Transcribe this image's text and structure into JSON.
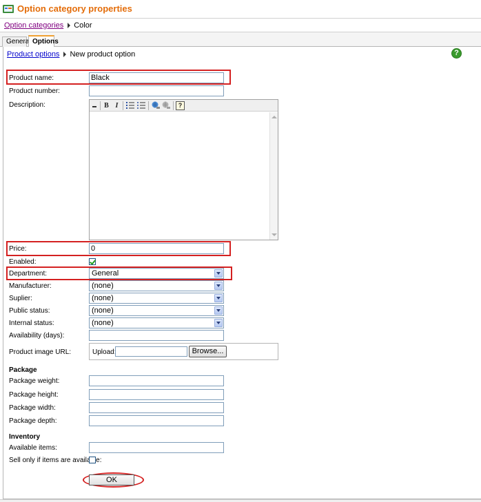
{
  "header": {
    "title": "Option category properties"
  },
  "breadcrumb": {
    "link": "Option categories",
    "current": "Color"
  },
  "tabs": [
    {
      "label": "General"
    },
    {
      "label": "Options"
    }
  ],
  "inner_breadcrumb": {
    "link": "Product options",
    "current": "New product option"
  },
  "help": {
    "glyph": "?"
  },
  "form": {
    "product_name": {
      "label": "Product name:",
      "value": "Black"
    },
    "product_number": {
      "label": "Product number:",
      "value": ""
    },
    "description": {
      "label": "Description:"
    },
    "price": {
      "label": "Price:",
      "value": "0"
    },
    "enabled": {
      "label": "Enabled:",
      "checked": true
    },
    "department": {
      "label": "Department:",
      "value": "General"
    },
    "manufacturer": {
      "label": "Manufacturer:",
      "value": "(none)"
    },
    "supplier": {
      "label": "Suplier:",
      "value": "(none)"
    },
    "public_status": {
      "label": "Public status:",
      "value": "(none)"
    },
    "internal_status": {
      "label": "Internal status:",
      "value": "(none)"
    },
    "availability": {
      "label": "Availability (days):",
      "value": ""
    },
    "image": {
      "label": "Product image URL:",
      "upload_label": "Upload:",
      "browse_label": "Browse..."
    }
  },
  "package": {
    "heading": "Package",
    "weight_label": "Package weight:",
    "height_label": "Package height:",
    "width_label": "Package width:",
    "depth_label": "Package depth:"
  },
  "inventory": {
    "heading": "Inventory",
    "available_label": "Available items:",
    "sell_only_label": "Sell only if items are available:",
    "sell_only_checked": false
  },
  "toolbar_glyphs": {
    "bold": "B",
    "italic": "I",
    "help": "?"
  },
  "actions": {
    "ok_label": "OK"
  },
  "colors": {
    "title": "#e46d0a",
    "highlight": "#d42020",
    "help": "#3a9b2d"
  }
}
